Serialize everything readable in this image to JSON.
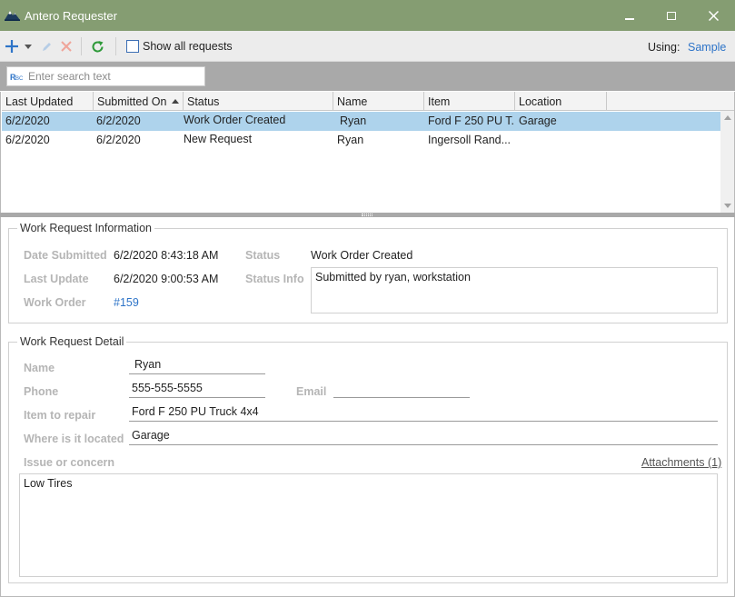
{
  "window": {
    "title": "Antero Requester",
    "icons": {
      "app": "mountain-logo-icon",
      "minimize": "minimize-icon",
      "maximize": "maximize-icon",
      "close": "close-icon"
    }
  },
  "toolbar": {
    "icons": [
      "add-icon",
      "dropdown-arrow-icon",
      "edit-icon",
      "delete-icon",
      "refresh-icon"
    ],
    "show_all_label": "Show all requests",
    "show_all_checked": false,
    "using_label": "Using:",
    "using_value": "Sample"
  },
  "search": {
    "placeholder": "Enter search text",
    "icon": "rbc-text-search-icon"
  },
  "grid": {
    "columns": [
      "Last Updated",
      "Submitted On",
      "Status",
      "Name",
      "Item",
      "Location"
    ],
    "sorted_column": "Submitted On",
    "sort_direction": "ascending",
    "rows": [
      {
        "last_updated": "6/2/2020",
        "submitted_on": "6/2/2020",
        "status": "Work Order Created",
        "name": "Ryan",
        "item": "Ford F 250 PU T...",
        "location": "Garage",
        "selected": true
      },
      {
        "last_updated": "6/2/2020",
        "submitted_on": "6/2/2020",
        "status": "New Request",
        "name": "Ryan",
        "item": "Ingersoll Rand...",
        "location": "",
        "selected": false
      }
    ]
  },
  "info": {
    "group_title": "Work Request Information",
    "date_submitted_label": "Date Submitted",
    "date_submitted": "6/2/2020 8:43:18 AM",
    "last_update_label": "Last Update",
    "last_update": "6/2/2020 9:00:53 AM",
    "work_order_label": "Work Order",
    "work_order": "#159",
    "status_label": "Status",
    "status": "Work Order Created",
    "status_info_label": "Status Info",
    "status_info": "Submitted by ryan, workstation"
  },
  "detail": {
    "group_title": "Work Request Detail",
    "name_label": "Name",
    "name": "Ryan",
    "phone_label": "Phone",
    "phone": "555-555-5555",
    "email_label": "Email",
    "email": "",
    "item_label": "Item to repair",
    "item": "Ford F 250 PU Truck 4x4",
    "location_label": "Where is it located",
    "location": "Garage",
    "issue_label": "Issue or concern",
    "attachments": "Attachments (1)",
    "issue": "Low Tires"
  },
  "colors": {
    "titlebar": "#859d72",
    "selection": "#aed3ec",
    "accent": "#2e74c8",
    "refresh": "#2f9a3a",
    "delete": "#f0a59a"
  }
}
